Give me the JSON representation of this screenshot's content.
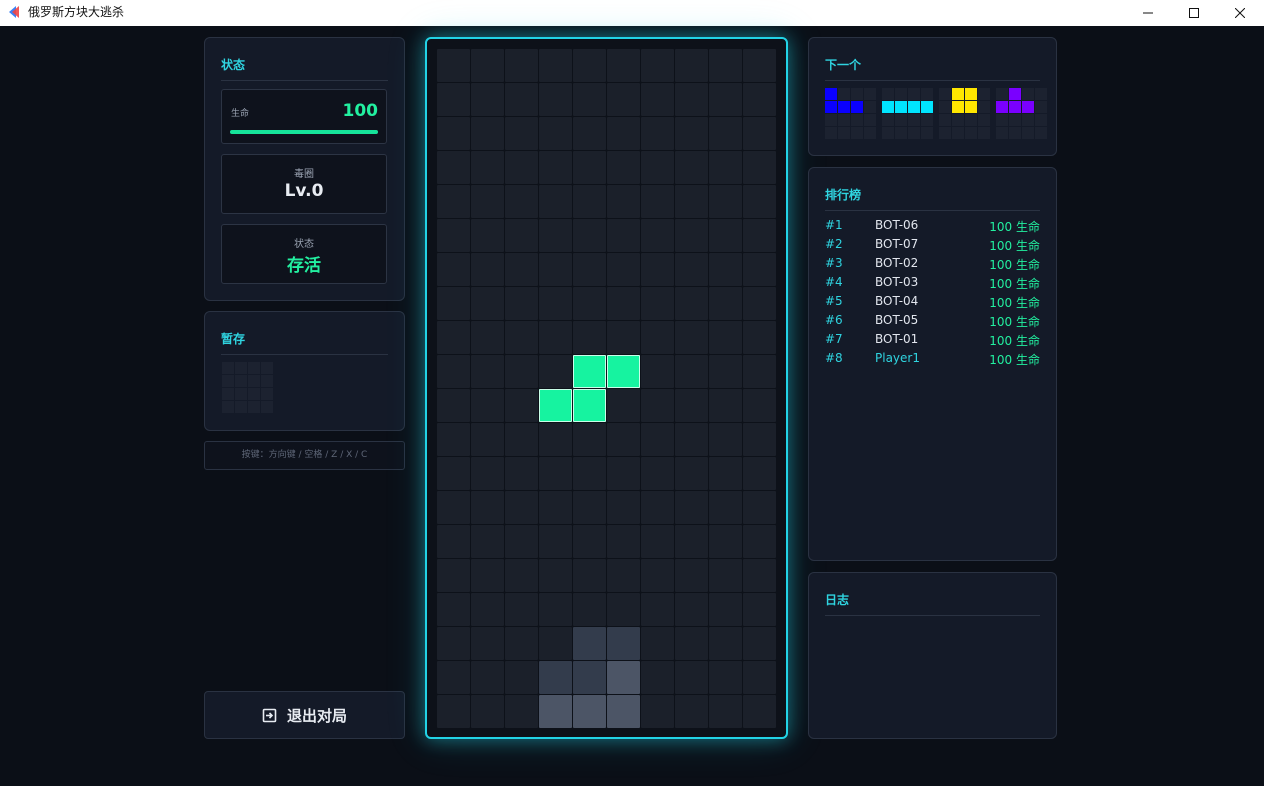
{
  "window": {
    "title": "俄罗斯方块大逃杀"
  },
  "status_panel": {
    "title": "状态",
    "hp": {
      "label": "生命",
      "value": "100",
      "fraction": 1.0
    },
    "poison": {
      "label": "毒圈",
      "value": "Lv.0"
    },
    "state": {
      "label": "状态",
      "value": "存活"
    }
  },
  "hold_panel": {
    "title": "暂存"
  },
  "controls_hint": "按键：方向键 / 空格 / Z / X / C",
  "exit_button": {
    "label": "退出对局"
  },
  "next_panel": {
    "title": "下一个",
    "pieces": [
      {
        "name": "J",
        "color": "#0a00ff",
        "cells": [
          [
            0,
            0
          ],
          [
            1,
            0
          ],
          [
            1,
            1
          ],
          [
            1,
            2
          ]
        ]
      },
      {
        "name": "I",
        "color": "#00e5ff",
        "cells": [
          [
            1,
            0
          ],
          [
            1,
            1
          ],
          [
            1,
            2
          ],
          [
            1,
            3
          ]
        ]
      },
      {
        "name": "O",
        "color": "#ffe600",
        "cells": [
          [
            0,
            1
          ],
          [
            0,
            2
          ],
          [
            1,
            1
          ],
          [
            1,
            2
          ]
        ]
      },
      {
        "name": "T",
        "color": "#7a00ff",
        "cells": [
          [
            0,
            1
          ],
          [
            1,
            0
          ],
          [
            1,
            1
          ],
          [
            1,
            2
          ]
        ]
      }
    ]
  },
  "leaderboard": {
    "title": "排行榜",
    "rows": [
      {
        "rank": "#1",
        "name": "BOT-06",
        "hp": "100 生命"
      },
      {
        "rank": "#2",
        "name": "BOT-07",
        "hp": "100 生命"
      },
      {
        "rank": "#3",
        "name": "BOT-02",
        "hp": "100 生命"
      },
      {
        "rank": "#4",
        "name": "BOT-03",
        "hp": "100 生命"
      },
      {
        "rank": "#5",
        "name": "BOT-04",
        "hp": "100 生命"
      },
      {
        "rank": "#6",
        "name": "BOT-05",
        "hp": "100 生命"
      },
      {
        "rank": "#7",
        "name": "BOT-01",
        "hp": "100 生命"
      },
      {
        "rank": "#8",
        "name": "Player1",
        "hp": "100 生命",
        "self": true
      }
    ]
  },
  "log_panel": {
    "title": "日志"
  },
  "board": {
    "cols": 10,
    "rows": 20,
    "active_color": "#16f3a0",
    "active": [
      [
        9,
        4
      ],
      [
        9,
        5
      ],
      [
        10,
        3
      ],
      [
        10,
        4
      ]
    ],
    "ghost": [
      [
        17,
        4
      ],
      [
        17,
        5
      ],
      [
        18,
        3
      ],
      [
        18,
        4
      ]
    ],
    "ghost_light": [
      [
        18,
        5
      ],
      [
        19,
        3
      ],
      [
        19,
        4
      ],
      [
        19,
        5
      ]
    ]
  },
  "colors": {
    "accent": "#22d3e6",
    "hp": "#22f0a0",
    "panel_title": "#2fd4e0"
  }
}
